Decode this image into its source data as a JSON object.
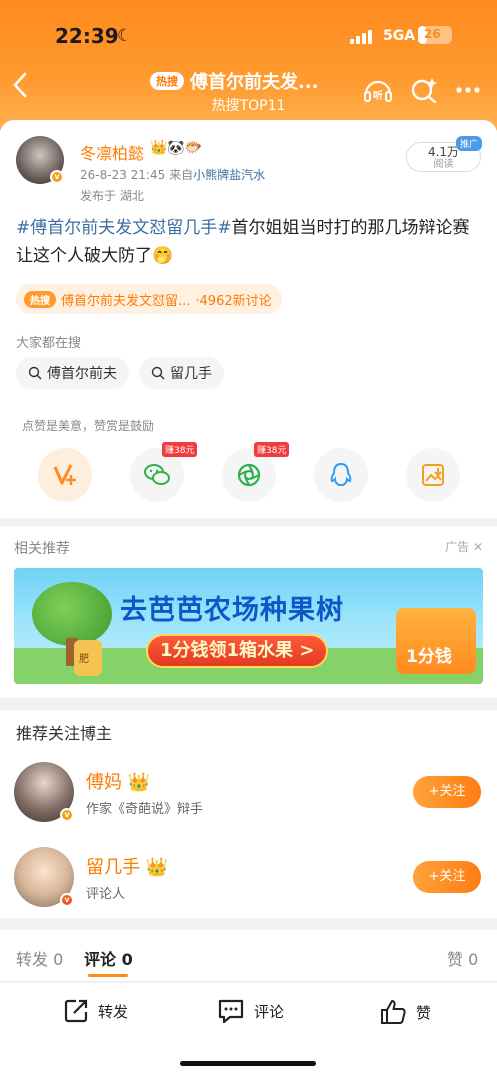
{
  "status_bar": {
    "time": "22:39",
    "network": "5GA",
    "battery": "26",
    "battery_level": 0.26
  },
  "nav": {
    "back_icon": "chevron-left-icon",
    "hot_badge": "热搜",
    "title": "傅首尔前夫发...",
    "subtitle": "热搜TOP11",
    "listen_label": "听",
    "icons": [
      "listen-icon",
      "sparkle-search-icon",
      "more-icon"
    ]
  },
  "post": {
    "author": "冬凛柏懿",
    "author_emojis": "👑🐼🐡",
    "time": "26-8-23 21:45",
    "source_prefix": "来自",
    "source": "小熊牌盐汽水",
    "location": "发布于 湖北",
    "reads": "4.1万",
    "reads_label": "阅读",
    "promo_tag": "推广",
    "hashtag": "#傅首尔前夫发文怼留几手#",
    "text": "首尔姐姐当时打的那几场辩论赛让这个人破大防了",
    "emoji": "🤭"
  },
  "topic": {
    "badge": "热搜",
    "name": "傅首尔前夫发文怼留...",
    "count": "·4962新讨论"
  },
  "searches": {
    "label": "大家都在搜",
    "items": [
      "傅首尔前夫",
      "留几手"
    ]
  },
  "share": {
    "hint": "点赞是美意，赞赏是鼓励",
    "reward_badge": "赚38元",
    "buttons": [
      "vplus-icon",
      "wechat-icon",
      "moments-icon",
      "qq-icon",
      "save-image-icon"
    ]
  },
  "recommend": {
    "title": "相关推荐",
    "ad_label": "广告",
    "banner": {
      "headline": "去芭芭农场种果树",
      "cta": "1分钱领1箱水果 >",
      "price": "1分钱",
      "jar_label": "肥"
    }
  },
  "follow": {
    "title": "推荐关注博主",
    "bloggers": [
      {
        "name": "傅妈",
        "desc": "作家《奇葩说》辩手",
        "button": "+关注"
      },
      {
        "name": "留几手",
        "desc": "评论人",
        "button": "+关注"
      }
    ]
  },
  "tabs": {
    "repost": "转发 0",
    "comment": "评论 0",
    "like": "赞 0"
  },
  "bottom_bar": {
    "repost": "转发",
    "comment": "评论",
    "like": "赞"
  },
  "colors": {
    "accent": "#ff8a1e",
    "link": "#3b6ea5",
    "brand_orange": "#ff7a00"
  }
}
